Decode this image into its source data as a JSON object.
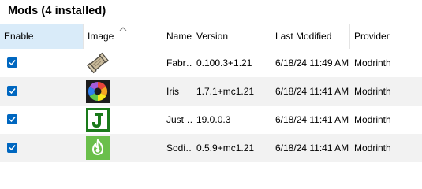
{
  "title": "Mods (4 installed)",
  "columns": [
    "Enable",
    "Image",
    "Name",
    "Version",
    "Last Modified",
    "Provider"
  ],
  "mods": [
    {
      "enabled": true,
      "icon": "fabric-scroll-icon",
      "name": "Fabr…",
      "version": "0.100.3+1.21",
      "modified": "6/18/24 11:49 AM",
      "provider": "Modrinth"
    },
    {
      "enabled": true,
      "icon": "iris-aperture-icon",
      "name": "Iris",
      "version": "1.7.1+mc1.21",
      "modified": "6/18/24 11:41 AM",
      "provider": "Modrinth"
    },
    {
      "enabled": true,
      "icon": "just-enough-items-j-icon",
      "name": "Just …",
      "version": "19.0.0.3",
      "modified": "6/18/24 11:41 AM",
      "provider": "Modrinth"
    },
    {
      "enabled": true,
      "icon": "sodium-flame-icon",
      "name": "Sodi…",
      "version": "0.5.9+mc1.21",
      "modified": "6/18/24 11:41 AM",
      "provider": "Modrinth"
    }
  ],
  "colors": {
    "checkbox": "#0067c0",
    "selected_header": "#d9ebf9",
    "alt_row": "#f2f2f2"
  }
}
